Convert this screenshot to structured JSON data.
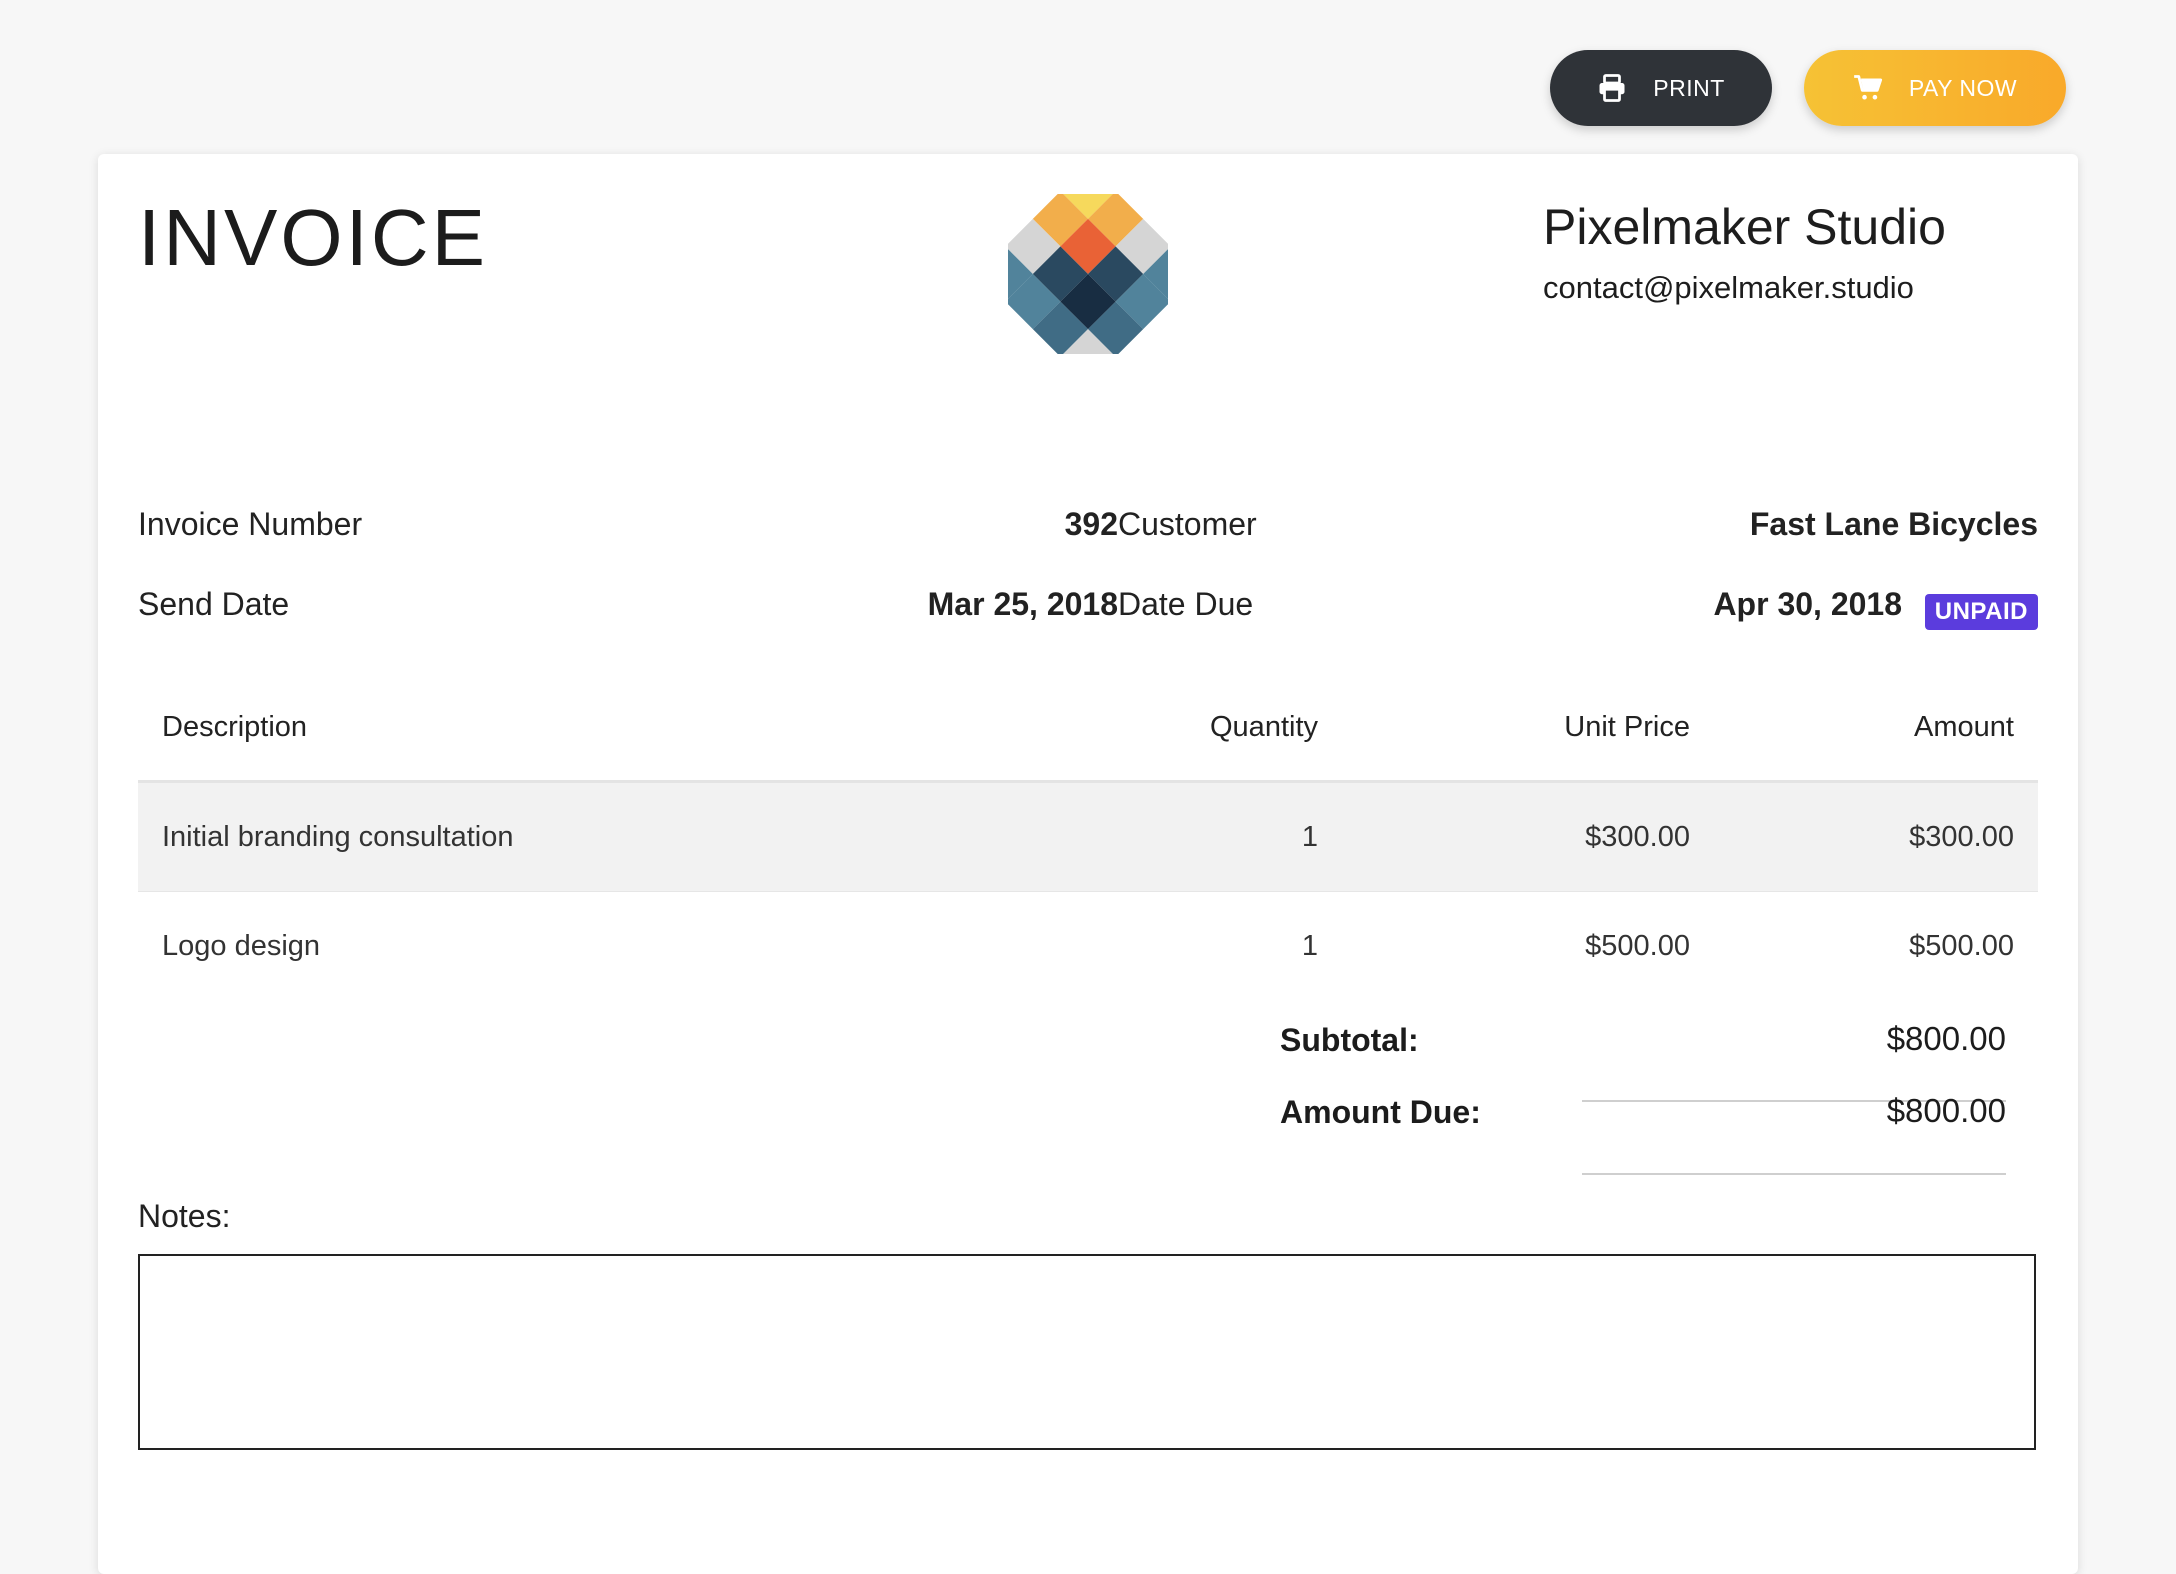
{
  "toolbar": {
    "print_label": "PRINT",
    "pay_label": "PAY NOW",
    "print_icon": "printer-icon",
    "pay_icon": "cart-icon"
  },
  "header": {
    "title": "INVOICE",
    "company_name": "Pixelmaker Studio",
    "company_email": "contact@pixelmaker.studio",
    "logo_icon": "diamond-grid-logo"
  },
  "meta": {
    "invoice_number_label": "Invoice Number",
    "invoice_number": "392",
    "send_date_label": "Send Date",
    "send_date": "Mar 25, 2018",
    "customer_label": "Customer",
    "customer": "Fast Lane Bicycles",
    "date_due_label": "Date Due",
    "date_due": "Apr 30, 2018",
    "status": "UNPAID"
  },
  "table": {
    "headers": [
      "Description",
      "Quantity",
      "Unit Price",
      "Amount"
    ],
    "rows": [
      [
        "Initial branding consultation",
        "1",
        "$300.00",
        "$300.00"
      ],
      [
        "Logo design",
        "1",
        "$500.00",
        "$500.00"
      ]
    ]
  },
  "totals": {
    "subtotal_label": "Subtotal:",
    "subtotal": "$800.00",
    "amount_due_label": "Amount Due:",
    "amount_due": "$800.00"
  },
  "notes": {
    "label": "Notes:",
    "value": ""
  },
  "colors": {
    "print_button": "#2f3338",
    "pay_button": "#f8b52f",
    "status_badge": "#5b3cdd"
  }
}
